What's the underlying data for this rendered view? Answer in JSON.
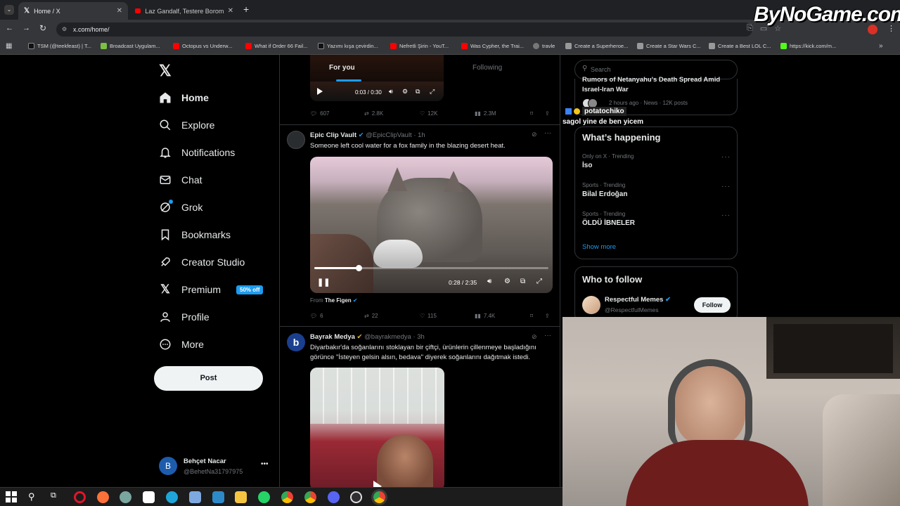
{
  "browser": {
    "tabs": [
      {
        "title": "Home / X",
        "active": true
      },
      {
        "title": "Laz Gandalf, Testere Boromir'e K",
        "active": false
      }
    ],
    "url": "x.com/home/",
    "bookmarks": [
      {
        "label": "TSM (@teekfeast) | T...",
        "color": "#ffffff"
      },
      {
        "label": "Broadcast Uygulam...",
        "color": "#7bc043"
      },
      {
        "label": "Octopus vs Underw...",
        "color": "#ff0000"
      },
      {
        "label": "What if Order 66 Fail...",
        "color": "#ff0000"
      },
      {
        "label": "Yazımı kışa çevirdin...",
        "color": "#ffffff"
      },
      {
        "label": "Nefretli Şirin - YouT...",
        "color": "#ff0000"
      },
      {
        "label": "Was Cypher, the Trai...",
        "color": "#ff0000"
      },
      {
        "label": "travle",
        "color": "#cccccc"
      },
      {
        "label": "Create a Superheroe...",
        "color": "#cccccc"
      },
      {
        "label": "Create a Star Wars C...",
        "color": "#cccccc"
      },
      {
        "label": "Create a Best LOL C...",
        "color": "#cccccc"
      },
      {
        "label": "https://kick.com/m...",
        "color": "#53fc18"
      }
    ]
  },
  "watermark": "ByNoGame.com",
  "sidebar": {
    "nav": [
      {
        "label": "Home",
        "icon": "home-icon"
      },
      {
        "label": "Explore",
        "icon": "search-icon"
      },
      {
        "label": "Notifications",
        "icon": "bell-icon"
      },
      {
        "label": "Chat",
        "icon": "envelope-icon"
      },
      {
        "label": "Grok",
        "icon": "grok-icon"
      },
      {
        "label": "Bookmarks",
        "icon": "bookmark-icon"
      },
      {
        "label": "Creator Studio",
        "icon": "rocket-icon"
      },
      {
        "label": "Premium",
        "icon": "x-icon"
      },
      {
        "label": "Profile",
        "icon": "person-icon"
      },
      {
        "label": "More",
        "icon": "more-circle-icon"
      }
    ],
    "premium_badge": "50% off",
    "post_button": "Post",
    "account": {
      "name": "Behçet Nacar",
      "handle": "@BehetNa31797975",
      "initial": "B"
    }
  },
  "feed": {
    "tabs": {
      "for_you": "For you",
      "following": "Following"
    },
    "prev_post": {
      "video_time": "0:03 / 0:30",
      "stats": {
        "replies": "607",
        "reposts": "2.8K",
        "likes": "12K",
        "views": "2.3M"
      }
    },
    "post1": {
      "author": "Epic Clip Vault",
      "handle": "@EpicClipVault",
      "time": "· 1h",
      "text": "Someone left cool water for a fox family in the blazing desert heat.",
      "video_time": "0:28 / 2:35",
      "video_progress": 0.19,
      "from_label": "From",
      "from_source": "The Figen",
      "stats": {
        "replies": "6",
        "reposts": "22",
        "likes": "115",
        "views": "7.4K"
      }
    },
    "post2": {
      "author": "Bayrak Medya",
      "handle": "@bayrakmedya",
      "time": "· 3h",
      "avatar": "b",
      "text_line1": "Diyarbakır'da soğanlarını stoklayan bir çiftçi, ürünlerin çillenmeye başladığını",
      "text_line2": "görünce \"İsteyen gelsin alsın, bedava\" diyerek soğanlarını dağıtmak istedi."
    }
  },
  "right": {
    "search_placeholder": "Search",
    "top_news": {
      "title_line1": "Rumors of Netanyahu's Death Spread Amid",
      "title_line2": "Israel-Iran War",
      "meta": "2 hours ago · News · 12K posts"
    },
    "happening_title": "What’s happening",
    "trends": [
      {
        "category": "Only on X · Trending",
        "name": "İso"
      },
      {
        "category": "Sports · Trending",
        "name": "Bilal Erdoğan"
      },
      {
        "category": "Sports · Trending",
        "name": "ÖLDÜ İBNELER"
      }
    ],
    "show_more": "Show more",
    "who_to_follow": "Who to follow",
    "suggestion": {
      "name": "Respectful Memes",
      "handle": "@RespectfulMemes",
      "button": "Follow"
    }
  },
  "chat_overlay": {
    "user": "potatochiko",
    "message": "sagol yine de ben yicem"
  }
}
